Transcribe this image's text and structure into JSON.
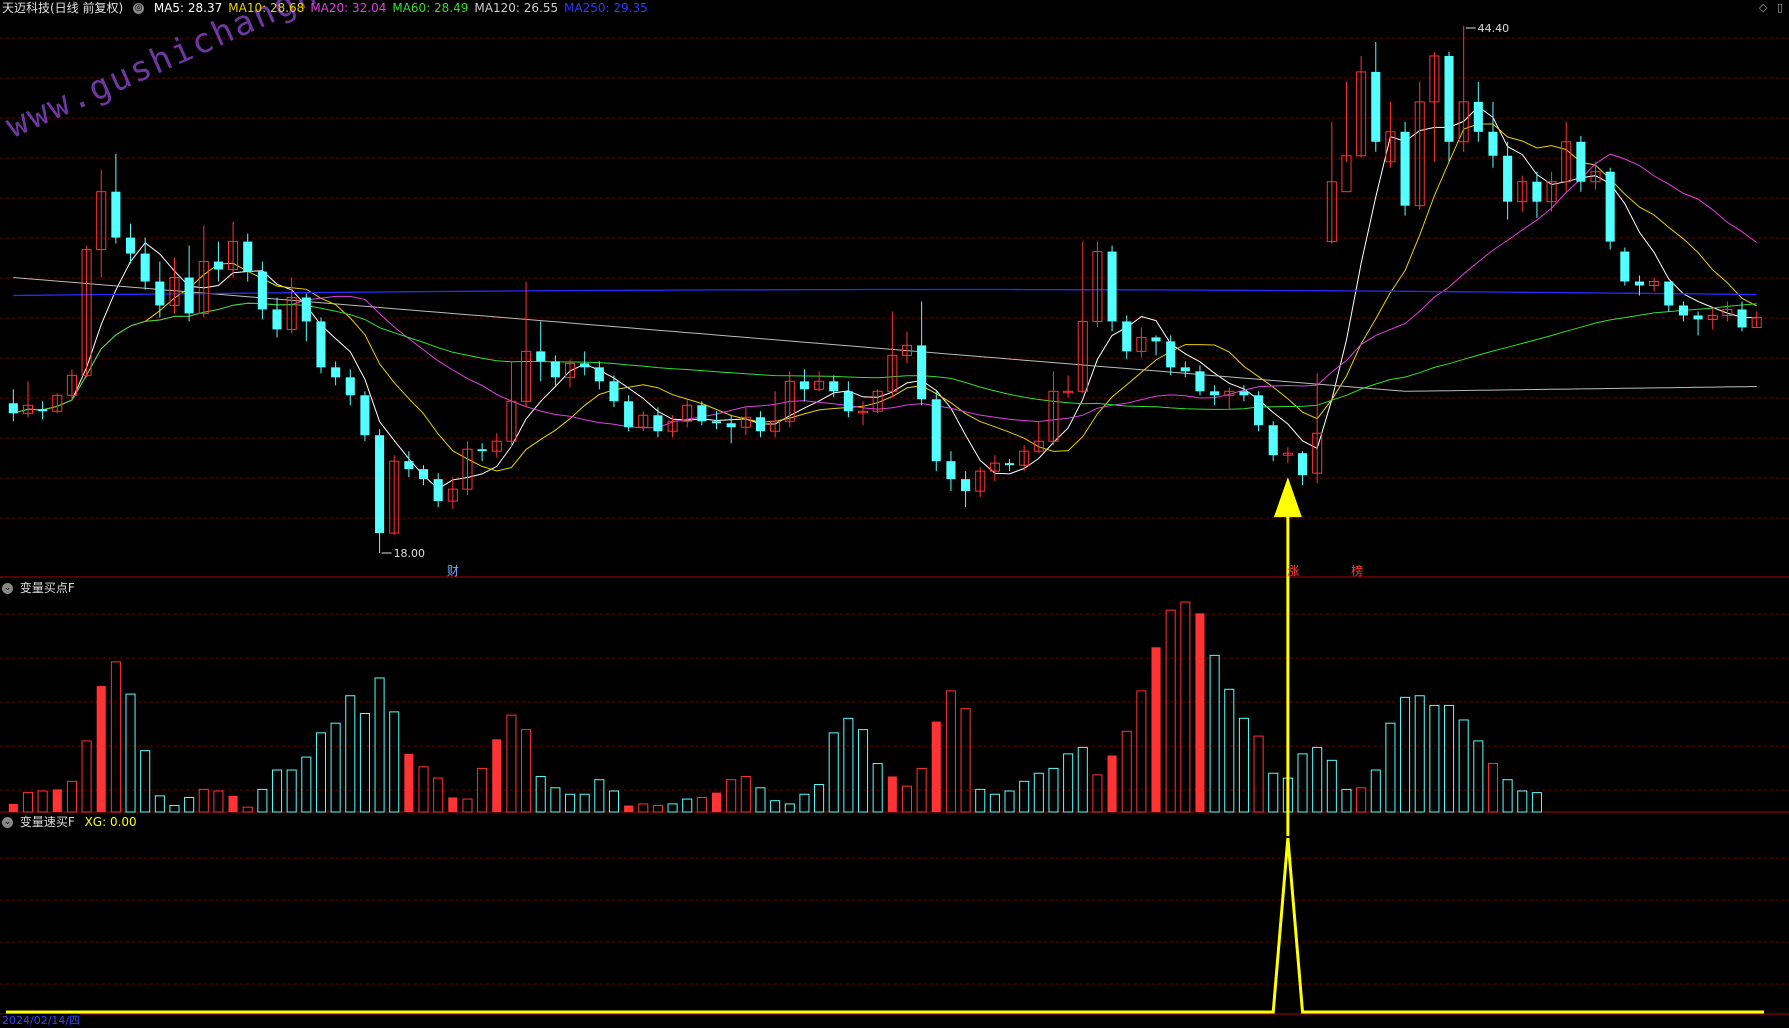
{
  "header": {
    "stock": "天迈科技(日线 前复权)",
    "ma": [
      {
        "label": "MA5: 28.37",
        "color": "#ffffff"
      },
      {
        "label": "MA10: 28.68",
        "color": "#e6d200"
      },
      {
        "label": "MA20: 32.04",
        "color": "#e040e0"
      },
      {
        "label": "MA60: 28.49",
        "color": "#33dd33"
      },
      {
        "label": "MA120: 26.55",
        "color": "#cccccc"
      },
      {
        "label": "MA250: 29.35",
        "color": "#3333ff"
      }
    ]
  },
  "top_right_icons": [
    "diamond-icon",
    "window-icon"
  ],
  "watermark": "www.gushichanghong.com",
  "price_annotations": {
    "high": "44.40",
    "low": "18.00"
  },
  "markers": [
    {
      "text": "财",
      "color": "#6fa8ff"
    },
    {
      "text": "涨",
      "color": "#ff4040"
    },
    {
      "text": "榜",
      "color": "#ff4040"
    }
  ],
  "panel2": {
    "title": "变量买点F"
  },
  "panel3": {
    "title": "变量速买F",
    "xg_label": "XG: 0.00"
  },
  "bottom_axis": {
    "date_text": "2024/02/14/四"
  },
  "colors": {
    "up": "#ff3333",
    "down": "#54ffff",
    "grid": "#8b0000",
    "signal": "#ffff00"
  },
  "chart_data": {
    "type": "candlestick",
    "ylim": [
      18,
      44.4
    ],
    "candles": [
      [
        25.5,
        25,
        26.2,
        24.6
      ],
      [
        25,
        25.4,
        26.6,
        24.8
      ],
      [
        25.2,
        25.1,
        25.6,
        24.7
      ],
      [
        25.1,
        25.9,
        26,
        25
      ],
      [
        25.9,
        26.9,
        27.2,
        25.6
      ],
      [
        26.9,
        33.2,
        33.4,
        26.8
      ],
      [
        33.2,
        36.1,
        37.2,
        31.8
      ],
      [
        36.1,
        33.8,
        38,
        33.5
      ],
      [
        33.8,
        33,
        34.5,
        32.5
      ],
      [
        33,
        31.6,
        33.8,
        31.2
      ],
      [
        31.6,
        30.4,
        32.6,
        29.8
      ],
      [
        30.4,
        31.8,
        32.8,
        30
      ],
      [
        31.8,
        30,
        33.4,
        29.6
      ],
      [
        30,
        32.6,
        34.4,
        29.8
      ],
      [
        32.6,
        32.2,
        33.6,
        31.6
      ],
      [
        32.2,
        33.6,
        34.6,
        31.8
      ],
      [
        33.6,
        32.1,
        34,
        31.6
      ],
      [
        32.1,
        30.2,
        32.6,
        29.7
      ],
      [
        30.2,
        29.2,
        30.8,
        28.8
      ],
      [
        29.2,
        30.8,
        31.8,
        29
      ],
      [
        30.8,
        29.6,
        31,
        28.6
      ],
      [
        29.6,
        27.3,
        29.8,
        27
      ],
      [
        27.3,
        26.8,
        27.6,
        26.4
      ],
      [
        26.8,
        25.9,
        27.2,
        25.4
      ],
      [
        25.9,
        23.9,
        26.1,
        23.6
      ],
      [
        23.9,
        19,
        24.2,
        18
      ],
      [
        19,
        22.6,
        22.9,
        18.9
      ],
      [
        22.6,
        22.2,
        23.1,
        21.8
      ],
      [
        22.2,
        21.7,
        22.4,
        21.4
      ],
      [
        21.7,
        20.6,
        22,
        20.3
      ],
      [
        20.6,
        21.2,
        21.8,
        20.2
      ],
      [
        21.2,
        23.2,
        23.6,
        20.9
      ],
      [
        23.2,
        23.1,
        23.5,
        22.6
      ],
      [
        23.1,
        23.6,
        24,
        22.8
      ],
      [
        23.6,
        25.6,
        27.6,
        23.3
      ],
      [
        25.6,
        28.1,
        31.6,
        25.3
      ],
      [
        28.1,
        27.6,
        29.6,
        26.6
      ],
      [
        27.6,
        26.8,
        27.9,
        26.4
      ],
      [
        26.8,
        27.5,
        27.7,
        26.3
      ],
      [
        27.5,
        27.3,
        28.1,
        26.9
      ],
      [
        27.3,
        26.6,
        27.6,
        26.2
      ],
      [
        26.6,
        25.6,
        26.9,
        25.3
      ],
      [
        25.6,
        24.3,
        25.9,
        24.1
      ],
      [
        24.3,
        24.9,
        25.1,
        24.1
      ],
      [
        24.9,
        24.1,
        25.3,
        23.8
      ],
      [
        24.1,
        24.6,
        24.9,
        23.8
      ],
      [
        24.6,
        25.4,
        25.7,
        24.3
      ],
      [
        25.4,
        24.6,
        25.6,
        24.4
      ],
      [
        24.6,
        24.5,
        25.1,
        24.2
      ],
      [
        24.5,
        24.3,
        24.9,
        23.5
      ],
      [
        24.3,
        24.8,
        25.3,
        23.9
      ],
      [
        24.8,
        24.1,
        25.1,
        23.8
      ],
      [
        24.1,
        24.6,
        26.1,
        23.8
      ],
      [
        24.6,
        26.6,
        27.1,
        24.3
      ],
      [
        26.6,
        26.2,
        27.2,
        25.6
      ],
      [
        26.2,
        26.6,
        27.1,
        26.1
      ],
      [
        26.6,
        26.1,
        26.9,
        25.8
      ],
      [
        26.1,
        25.1,
        26.6,
        24.8
      ],
      [
        25.1,
        25.1,
        25.6,
        24.4
      ],
      [
        25.1,
        26.1,
        26.2,
        25
      ],
      [
        26.1,
        27.9,
        30.1,
        25.8
      ],
      [
        27.9,
        28.4,
        29.1,
        27.5
      ],
      [
        28.4,
        25.7,
        30.6,
        25.4
      ],
      [
        25.7,
        22.6,
        26.1,
        22.1
      ],
      [
        22.6,
        21.7,
        23.1,
        21.1
      ],
      [
        21.7,
        21.1,
        22.1,
        20.3
      ],
      [
        21.1,
        22.1,
        22.3,
        20.8
      ],
      [
        22.1,
        22.5,
        22.9,
        21.6
      ],
      [
        22.5,
        22.4,
        22.7,
        22.1
      ],
      [
        22.4,
        23.1,
        23.4,
        22.1
      ],
      [
        23.1,
        23.6,
        24.6,
        23
      ],
      [
        23.6,
        26.1,
        27.1,
        23.4
      ],
      [
        26.1,
        26.1,
        26.9,
        25.8
      ],
      [
        26.1,
        29.6,
        33.6,
        26
      ],
      [
        29.6,
        33.1,
        33.6,
        29.3
      ],
      [
        33.1,
        29.6,
        33.4,
        29.1
      ],
      [
        29.6,
        28.1,
        29.9,
        27.7
      ],
      [
        28.1,
        28.8,
        29.3,
        27.8
      ],
      [
        28.8,
        28.6,
        28.9,
        27.9
      ],
      [
        28.6,
        27.3,
        28.9,
        26.9
      ],
      [
        27.3,
        27.1,
        27.6,
        26.8
      ],
      [
        27.1,
        26.1,
        27.4,
        25.9
      ],
      [
        26.1,
        25.9,
        26.4,
        25.4
      ],
      [
        25.9,
        26.1,
        26.3,
        25.2
      ],
      [
        26.1,
        25.9,
        26.4,
        25.6
      ],
      [
        25.9,
        24.4,
        26.1,
        24.1
      ],
      [
        24.4,
        22.9,
        24.6,
        22.6
      ],
      [
        22.9,
        23.0,
        23.3,
        22.5
      ],
      [
        23.0,
        21.9,
        23.1,
        21.4
      ],
      [
        22,
        24,
        27,
        21.5
      ],
      [
        33.6,
        36.6,
        39.6,
        33.5
      ],
      [
        36.1,
        37.9,
        41.6,
        37.6
      ],
      [
        37.9,
        42.1,
        42.9,
        37.8
      ],
      [
        42.1,
        38.6,
        43.6,
        38.1
      ],
      [
        37.6,
        39.1,
        40.6,
        37.3
      ],
      [
        39.1,
        35.4,
        39.6,
        34.9
      ],
      [
        35.4,
        40.6,
        41.6,
        35.2
      ],
      [
        40.6,
        42.9,
        43.1,
        37.6
      ],
      [
        42.9,
        38.6,
        43.1,
        37.6
      ],
      [
        38.6,
        40.6,
        44.4,
        38.1
      ],
      [
        40.6,
        39.1,
        41.6,
        38.6
      ],
      [
        39.1,
        37.9,
        40.6,
        37.3
      ],
      [
        37.9,
        35.6,
        38.6,
        34.7
      ],
      [
        35.6,
        36.6,
        36.9,
        35.1
      ],
      [
        36.6,
        35.6,
        37.1,
        34.8
      ],
      [
        35.6,
        36.6,
        37.1,
        35.1
      ],
      [
        36.6,
        38.6,
        39.6,
        36.1
      ],
      [
        38.6,
        36.6,
        38.9,
        36.1
      ],
      [
        36.6,
        37.1,
        37.6,
        36.2
      ],
      [
        37.1,
        33.6,
        37.3,
        33.2
      ],
      [
        33.1,
        31.6,
        33.3,
        31.4
      ],
      [
        31.6,
        31.4,
        31.9,
        30.9
      ],
      [
        31.4,
        31.6,
        31.8,
        31.1
      ],
      [
        31.6,
        30.4,
        31.6,
        30.1
      ],
      [
        30.4,
        29.9,
        30.6,
        29.6
      ],
      [
        29.9,
        29.7,
        30.1,
        28.9
      ],
      [
        29.7,
        29.9,
        30.3,
        29.2
      ],
      [
        29.9,
        30.2,
        30.6,
        29.6
      ],
      [
        30.2,
        29.3,
        30.6,
        29.1
      ],
      [
        29.3,
        29.8,
        30.1,
        29.3
      ]
    ],
    "volume": [
      [
        5,
        1
      ],
      [
        12,
        1
      ],
      [
        13,
        1
      ],
      [
        14,
        1
      ],
      [
        19,
        1
      ],
      [
        44,
        1
      ],
      [
        78,
        1
      ],
      [
        93,
        1
      ],
      [
        73,
        0
      ],
      [
        38,
        0
      ],
      [
        10,
        0
      ],
      [
        4,
        0
      ],
      [
        9,
        0
      ],
      [
        14,
        1
      ],
      [
        13,
        1
      ],
      [
        10,
        1
      ],
      [
        3,
        1
      ],
      [
        14,
        0
      ],
      [
        26,
        0
      ],
      [
        26,
        0
      ],
      [
        34,
        0
      ],
      [
        49,
        0
      ],
      [
        55,
        0
      ],
      [
        72,
        0
      ],
      [
        61,
        0
      ],
      [
        83,
        0
      ],
      [
        62,
        0
      ],
      [
        36,
        1
      ],
      [
        28,
        1
      ],
      [
        21,
        1
      ],
      [
        9,
        1
      ],
      [
        8,
        1
      ],
      [
        27,
        1
      ],
      [
        45,
        1
      ],
      [
        60,
        1
      ],
      [
        51,
        1
      ],
      [
        22,
        0
      ],
      [
        15,
        0
      ],
      [
        11,
        0
      ],
      [
        11,
        0
      ],
      [
        20,
        0
      ],
      [
        13,
        0
      ],
      [
        4,
        1
      ],
      [
        5,
        1
      ],
      [
        4,
        1
      ],
      [
        5,
        0
      ],
      [
        8,
        0
      ],
      [
        9,
        1
      ],
      [
        12,
        1
      ],
      [
        20,
        1
      ],
      [
        22,
        1
      ],
      [
        15,
        0
      ],
      [
        7,
        0
      ],
      [
        5,
        0
      ],
      [
        11,
        0
      ],
      [
        17,
        0
      ],
      [
        49,
        0
      ],
      [
        58,
        0
      ],
      [
        51,
        0
      ],
      [
        30,
        0
      ],
      [
        22,
        1
      ],
      [
        16,
        1
      ],
      [
        27,
        1
      ],
      [
        56,
        1
      ],
      [
        75,
        1
      ],
      [
        64,
        1
      ],
      [
        14,
        0
      ],
      [
        11,
        0
      ],
      [
        13,
        0
      ],
      [
        19,
        0
      ],
      [
        24,
        0
      ],
      [
        27,
        0
      ],
      [
        36,
        0
      ],
      [
        40,
        0
      ],
      [
        23,
        1
      ],
      [
        35,
        1
      ],
      [
        50,
        1
      ],
      [
        75,
        1
      ],
      [
        102,
        1
      ],
      [
        125,
        1
      ],
      [
        130,
        1
      ],
      [
        123,
        1
      ],
      [
        97,
        0
      ],
      [
        76,
        0
      ],
      [
        58,
        0
      ],
      [
        47,
        1
      ],
      [
        24,
        0
      ],
      [
        21,
        0
      ],
      [
        36,
        0
      ],
      [
        40,
        0
      ],
      [
        32,
        0
      ],
      [
        14,
        0
      ],
      [
        15,
        1
      ],
      [
        26,
        0
      ],
      [
        55,
        0
      ],
      [
        71,
        0
      ],
      [
        72,
        0
      ],
      [
        66,
        0
      ],
      [
        66,
        0
      ],
      [
        57,
        0
      ],
      [
        44,
        0
      ],
      [
        30,
        1
      ],
      [
        20,
        0
      ],
      [
        13,
        0
      ],
      [
        12,
        0
      ]
    ],
    "signal_index": 87,
    "xg_value": 0.0
  }
}
